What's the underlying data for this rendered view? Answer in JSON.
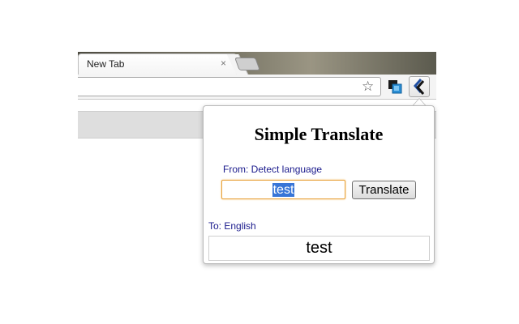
{
  "browser": {
    "tab_title": "New Tab",
    "tab_close": "×",
    "star_glyph": "☆"
  },
  "popup": {
    "title": "Simple Translate",
    "from_label": "From: Detect language",
    "input_value": "test",
    "translate_button": "Translate",
    "to_label": "To: English",
    "result": "test"
  },
  "colors": {
    "label_blue": "#1a1a8c",
    "input_focus_border": "#e8a33d",
    "selection_blue": "#3875d7"
  },
  "icons": [
    "star-icon",
    "extension-icon",
    "simple-translate-icon",
    "close-icon"
  ]
}
